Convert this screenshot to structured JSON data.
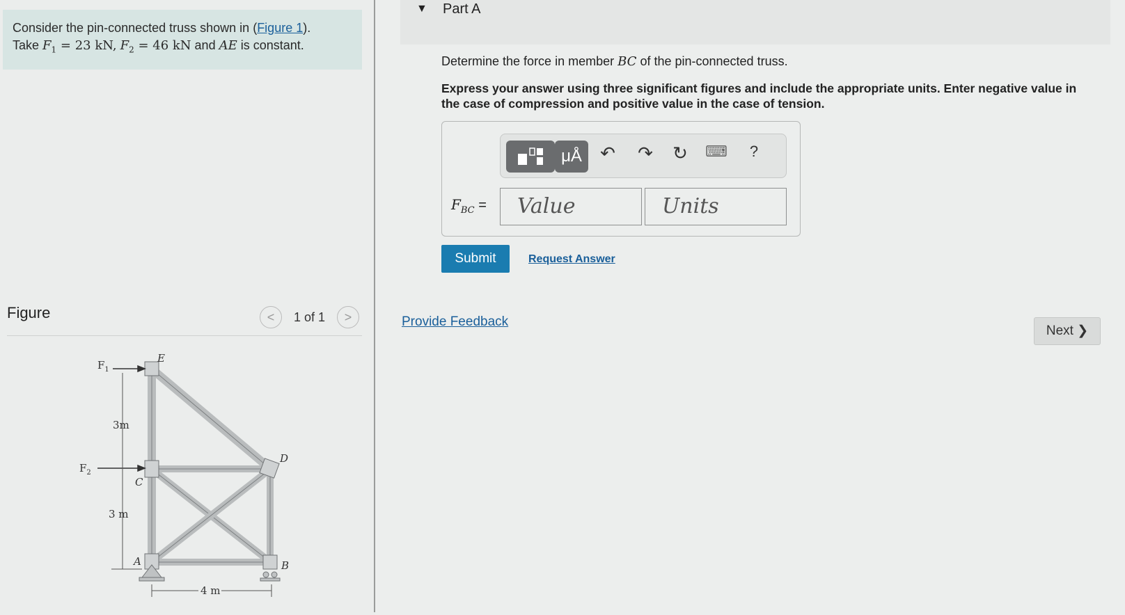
{
  "problem": {
    "line1_pre": "Consider the pin-connected truss shown in (",
    "figure_link": "Figure 1",
    "line1_post": ").",
    "take": "Take",
    "f1_var": "F",
    "f1_sub": "1",
    "f1_eq": " = 23 kN,",
    "f2_var": "F",
    "f2_sub": "2",
    "f2_eq": " = 46 kN",
    "and": " and ",
    "ae": "AE",
    "constant": " is constant."
  },
  "figure": {
    "title": "Figure",
    "prev": "<",
    "next": ">",
    "count": "1 of 1",
    "labels": {
      "f1": "F",
      "f1_sub": "1",
      "f2": "F",
      "f2_sub": "2",
      "e": "E",
      "d": "D",
      "c": "C",
      "a": "A",
      "b": "B",
      "dim_top": "3m",
      "dim_bottom": "3 m",
      "dim_width": "4 m"
    }
  },
  "part": {
    "arrow": "▼",
    "title": "Part A"
  },
  "question": {
    "pre": "Determine the force in member ",
    "member": "BC",
    "post": " of the pin-connected truss."
  },
  "instructions": "Express your answer using three significant figures and include the appropriate units. Enter negative value in the case of compression and positive value in the case of tension.",
  "answer": {
    "label_var": "F",
    "label_sub": "BC",
    "label_eq": " =",
    "value_placeholder": "Value",
    "units_placeholder": "Units",
    "toolbar": {
      "template_icon": "template-icon",
      "units_label": "μÅ",
      "undo": "↶",
      "redo": "↷",
      "reset": "↻",
      "keyboard": "⌨",
      "help": "?"
    }
  },
  "actions": {
    "submit": "Submit",
    "request": "Request Answer",
    "feedback": "Provide Feedback",
    "next": "Next ❯"
  }
}
